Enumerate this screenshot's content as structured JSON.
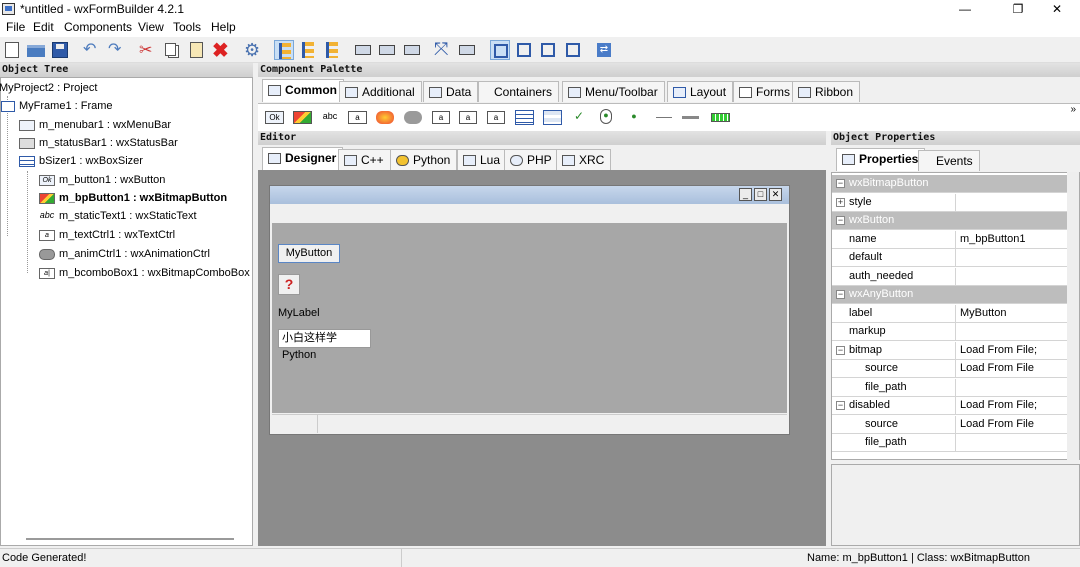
{
  "window": {
    "title": "*untitled - wxFormBuilder 4.2.1",
    "min_glyph": "—",
    "max_glyph": "❐",
    "close_glyph": "✕"
  },
  "menu": [
    "File",
    "Edit",
    "Components",
    "View",
    "Tools",
    "Help"
  ],
  "toolbar_icons": [
    "new-icon",
    "open-icon",
    "save-icon",
    "undo-icon",
    "redo-icon",
    "cut-icon",
    "copy-icon",
    "paste-icon",
    "delete-icon",
    "generate-code-icon",
    "align-left-icon",
    "align-center-icon",
    "align-right-icon",
    "align-top-icon",
    "align-middle-icon",
    "align-bottom-icon",
    "expand-icon",
    "stretch-icon",
    "border-left-icon",
    "border-right-icon",
    "border-top-icon",
    "border-bottom-icon",
    "swap-icon"
  ],
  "object_tree": {
    "header": "Object Tree",
    "items": [
      {
        "label": "MyProject2 : Project",
        "icon": "project-icon"
      },
      {
        "label": "MyFrame1 : Frame",
        "icon": "frame-icon"
      },
      {
        "label": "m_menubar1 : wxMenuBar",
        "icon": "menubar-icon"
      },
      {
        "label": "m_statusBar1 : wxStatusBar",
        "icon": "statusbar-icon"
      },
      {
        "label": "bSizer1 : wxBoxSizer",
        "icon": "boxsizer-icon"
      },
      {
        "label": "m_button1 : wxButton",
        "icon": "button-icon"
      },
      {
        "label": "m_bpButton1 : wxBitmapButton",
        "icon": "bitmapbutton-icon",
        "selected": true
      },
      {
        "label": "m_staticText1 : wxStaticText",
        "icon": "statictext-icon"
      },
      {
        "label": "m_textCtrl1 : wxTextCtrl",
        "icon": "textctrl-icon"
      },
      {
        "label": "m_animCtrl1 : wxAnimationCtrl",
        "icon": "animctrl-icon"
      },
      {
        "label": "m_bcomboBox1 : wxBitmapComboBox",
        "icon": "bitmapcombobox-icon"
      }
    ]
  },
  "palette": {
    "header": "Component Palette",
    "tabs": [
      "Common",
      "Additional",
      "Data",
      "Containers",
      "Menu/Toolbar",
      "Layout",
      "Forms",
      "Ribbon"
    ],
    "active_tab": "Common",
    "more_glyph": "»",
    "components": [
      "button-icon",
      "bitmapbutton-icon",
      "statictext-icon",
      "textctrl-icon",
      "staticbitmap-icon",
      "animctrl-icon",
      "combobox-icon",
      "bitmapcombobox-icon",
      "choice-icon",
      "listbox-icon",
      "listctrl-icon",
      "checkbox-icon",
      "radiobox-icon",
      "radiobutton-icon",
      "staticline-icon",
      "slider-icon",
      "gauge-icon"
    ]
  },
  "editor": {
    "header": "Editor",
    "tabs": [
      "Designer",
      "C++",
      "Python",
      "Lua",
      "PHP",
      "XRC"
    ],
    "active_tab": "Designer",
    "preview": {
      "button_label": "MyButton",
      "bitmap_glyph": "?",
      "label_text": "MyLabel",
      "textctrl_value": "小白这样学Python"
    }
  },
  "properties": {
    "header": "Object Properties",
    "tabs": [
      "Properties",
      "Events"
    ],
    "active_tab": "Properties",
    "rows": [
      {
        "type": "category",
        "name": "wxBitmapButton"
      },
      {
        "type": "prop",
        "name": "style",
        "value": "",
        "expand": "+"
      },
      {
        "type": "category",
        "name": "wxButton"
      },
      {
        "type": "prop",
        "name": "name",
        "value": "m_bpButton1"
      },
      {
        "type": "prop",
        "name": "default",
        "value": "",
        "checkbox": true
      },
      {
        "type": "prop",
        "name": "auth_needed",
        "value": "",
        "checkbox": true
      },
      {
        "type": "category",
        "name": "wxAnyButton"
      },
      {
        "type": "prop",
        "name": "label",
        "value": "MyButton"
      },
      {
        "type": "prop",
        "name": "markup",
        "value": "",
        "checkbox": true
      },
      {
        "type": "prop",
        "name": "bitmap",
        "value": "Load From File;",
        "expand": "−"
      },
      {
        "type": "sub",
        "name": "source",
        "value": "Load From File"
      },
      {
        "type": "sub",
        "name": "file_path",
        "value": "",
        "filepicker": true
      },
      {
        "type": "prop",
        "name": "disabled",
        "value": "Load From File;",
        "expand": "−"
      },
      {
        "type": "sub",
        "name": "source",
        "value": "Load From File"
      },
      {
        "type": "sub",
        "name": "file_path",
        "value": "",
        "filepicker": true
      }
    ]
  },
  "status": {
    "left": "Code Generated!",
    "right": "Name: m_bpButton1 | Class: wxBitmapButton"
  }
}
